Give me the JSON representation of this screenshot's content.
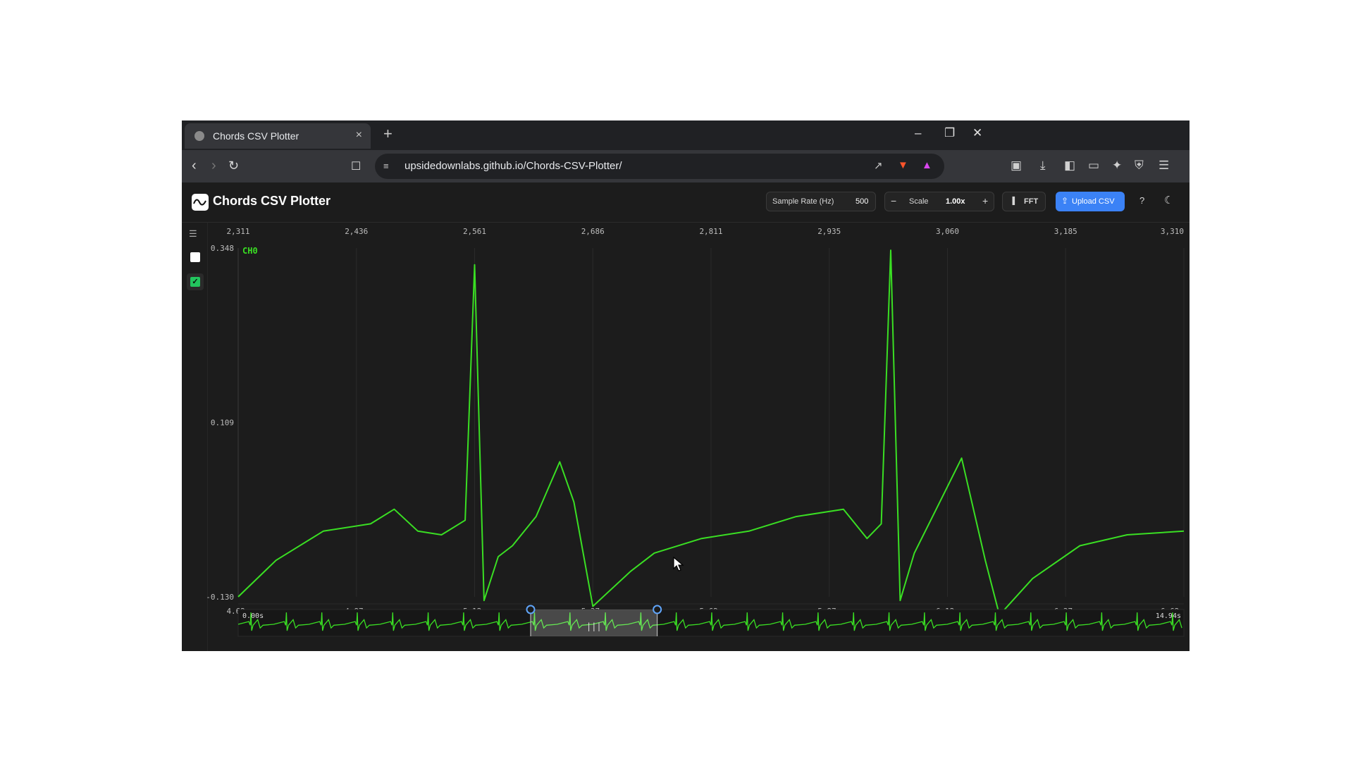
{
  "browser": {
    "tab_title": "Chords CSV Plotter",
    "tab_close": "×",
    "new_tab": "+",
    "url": "upsidedownlabs.github.io/Chords-CSV-Plotter/",
    "window_controls": {
      "minimize": "–",
      "restore": "❐",
      "close": "✕"
    }
  },
  "app": {
    "title": "Chords CSV Plotter",
    "sample_rate_label": "Sample Rate (Hz)",
    "sample_rate_value": "500",
    "scale_minus": "−",
    "scale_label": "Scale",
    "scale_value": "1.00x",
    "scale_plus": "+",
    "fft_label": "FFT",
    "upload_label": "Upload CSV",
    "help_label": "?",
    "icons": {
      "theme": "moon-icon",
      "upload": "upload-icon",
      "fft": "bar-chart-icon",
      "logo": "wave-logo-icon"
    }
  },
  "sidebar": {
    "channel_checked": true,
    "checkmark": "✓",
    "list_icon": "☰"
  },
  "colors": {
    "accent": "#3b82f6",
    "signal": "#3adf23",
    "background": "#1c1c1c"
  },
  "chart_data": {
    "type": "line",
    "series": [
      {
        "name": "CH0"
      }
    ],
    "x_top_ticks": [
      "2,311",
      "2,436",
      "2,561",
      "2,686",
      "2,811",
      "2,935",
      "3,060",
      "3,185",
      "3,310"
    ],
    "x_bottom_ticks": [
      "4.62s",
      "4.87s",
      "5.12s",
      "5.37s",
      "5.62s",
      "5.87s",
      "6.12s",
      "6.37s",
      "6.62s"
    ],
    "y_ticks": [
      "0.348",
      "0.109",
      "-0.130"
    ],
    "ylim": [
      -0.13,
      0.348
    ],
    "xlim_seconds": [
      4.62,
      6.62
    ],
    "x": [
      4.62,
      4.7,
      4.8,
      4.9,
      4.95,
      5.0,
      5.05,
      5.1,
      5.12,
      5.14,
      5.17,
      5.2,
      5.25,
      5.3,
      5.33,
      5.37,
      5.4,
      5.45,
      5.5,
      5.6,
      5.7,
      5.8,
      5.9,
      5.95,
      5.98,
      6.0,
      6.02,
      6.05,
      6.1,
      6.15,
      6.2,
      6.23,
      6.3,
      6.4,
      6.5,
      6.62
    ],
    "y": [
      -0.13,
      -0.08,
      -0.04,
      -0.03,
      -0.01,
      -0.04,
      -0.045,
      -0.025,
      0.325,
      -0.135,
      -0.075,
      -0.06,
      -0.02,
      0.055,
      0.0,
      -0.143,
      -0.125,
      -0.095,
      -0.07,
      -0.05,
      -0.04,
      -0.02,
      -0.01,
      -0.05,
      -0.03,
      0.345,
      -0.135,
      -0.07,
      -0.005,
      0.06,
      -0.08,
      -0.155,
      -0.105,
      -0.06,
      -0.045,
      -0.04
    ],
    "overview": {
      "start_label": "0.00s",
      "end_label": "14.94s",
      "window": [
        4.62,
        6.62
      ]
    }
  }
}
